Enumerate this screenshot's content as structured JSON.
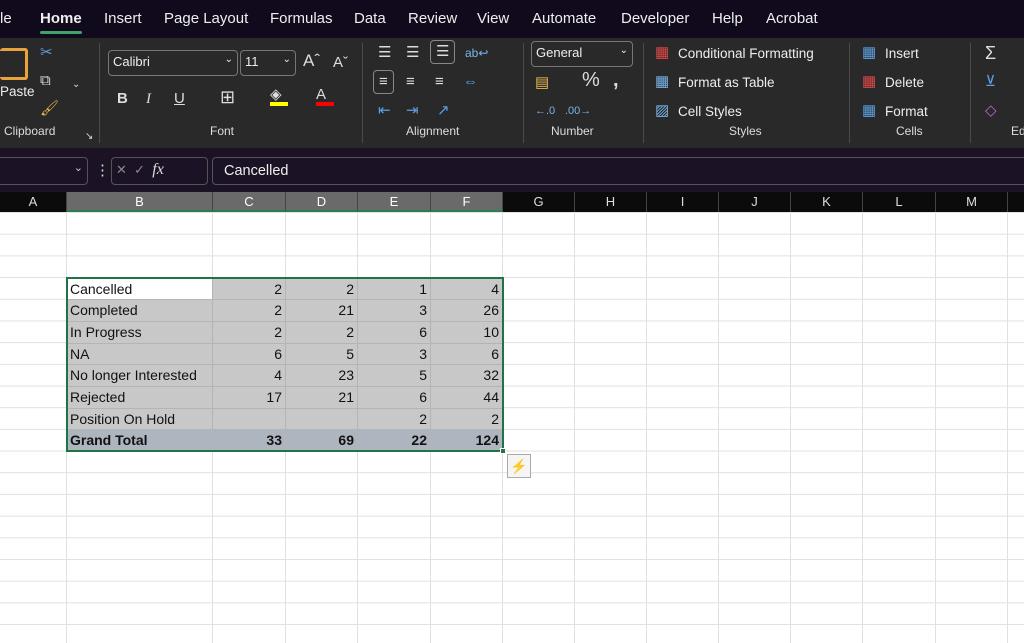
{
  "tabs": [
    "le",
    "Home",
    "Insert",
    "Page Layout",
    "Formulas",
    "Data",
    "Review",
    "View",
    "Automate",
    "Developer",
    "Help",
    "Acrobat"
  ],
  "ribbon": {
    "clipboard": {
      "paste": "Paste",
      "label": "Clipboard"
    },
    "font": {
      "name": "Calibri",
      "size": "11",
      "label": "Font",
      "fill_color": "#ffff00",
      "font_color": "#ff0000"
    },
    "alignment": {
      "label": "Alignment"
    },
    "number": {
      "format": "General",
      "label": "Number"
    },
    "styles": {
      "conditional": "Conditional Formatting",
      "format_table": "Format as Table",
      "cell_styles": "Cell Styles",
      "label": "Styles"
    },
    "cells": {
      "insert": "Insert",
      "delete": "Delete",
      "format": "Format",
      "label": "Cells"
    },
    "editing": {
      "label": "Ed"
    }
  },
  "formula_bar": {
    "name_box": "",
    "content": "Cancelled",
    "fx": "fx"
  },
  "columns": [
    "A",
    "B",
    "C",
    "D",
    "E",
    "F",
    "G",
    "H",
    "I",
    "J",
    "K",
    "L",
    "M"
  ],
  "table": {
    "rows": [
      {
        "label": "Cancelled",
        "values": [
          "2",
          "2",
          "1",
          "4"
        ]
      },
      {
        "label": "Completed",
        "values": [
          "2",
          "21",
          "3",
          "26"
        ]
      },
      {
        "label": "In Progress",
        "values": [
          "2",
          "2",
          "6",
          "10"
        ]
      },
      {
        "label": "NA",
        "values": [
          "6",
          "5",
          "3",
          "6"
        ]
      },
      {
        "label": "No longer Interested",
        "values": [
          "4",
          "23",
          "5",
          "32"
        ]
      },
      {
        "label": "Rejected",
        "values": [
          "17",
          "21",
          "6",
          "44"
        ]
      },
      {
        "label": "Position On Hold",
        "values": [
          "",
          "",
          "2",
          "2"
        ]
      }
    ],
    "total": {
      "label": "Grand Total",
      "values": [
        "33",
        "69",
        "22",
        "124"
      ]
    }
  },
  "colors": {
    "selection": "#217346",
    "table_fill": "#c8c8c8",
    "total_fill": "#adb5bf"
  }
}
